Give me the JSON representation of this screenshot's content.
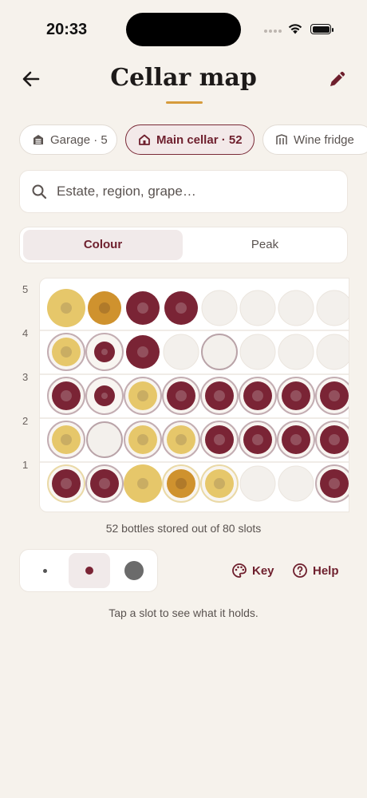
{
  "status_bar": {
    "time": "20:33"
  },
  "header": {
    "title": "Cellar map",
    "back_icon": "arrow-left-icon",
    "edit_icon": "pencil-icon",
    "accent_color": "#d69b3c"
  },
  "locations": [
    {
      "label": "Garage · 5",
      "icon": "garage-icon",
      "active": false
    },
    {
      "label": "Main cellar · 52",
      "icon": "house-icon",
      "active": true
    },
    {
      "label": "Wine fridge",
      "icon": "fridge-icon",
      "active": false
    }
  ],
  "search": {
    "placeholder": "Estate, region, grape…",
    "value": ""
  },
  "view_toggle": {
    "options": [
      "Colour",
      "Peak"
    ],
    "selected": "Colour"
  },
  "rack": {
    "row_labels": [
      "5",
      "4",
      "3",
      "2",
      "1"
    ],
    "visible_columns": 8,
    "colors": {
      "red": "#7a2435",
      "white": "#e6c76a",
      "amber": "#cf922e",
      "empty": "#f3f0ec"
    },
    "rows": [
      {
        "row": "5",
        "slots": [
          "white-large",
          "amber",
          "red",
          "red",
          "empty",
          "empty",
          "empty",
          "empty"
        ]
      },
      {
        "row": "4",
        "slots": [
          "white-ringed",
          "red-small-ringed",
          "red",
          "empty",
          "empty-ringed",
          "empty",
          "empty",
          "empty"
        ]
      },
      {
        "row": "3",
        "slots": [
          "red-ringed",
          "red-small-ringed",
          "white-ringed",
          "red-ringed",
          "red-ringed",
          "red-ringed",
          "red-ringed",
          "red-ringed"
        ]
      },
      {
        "row": "2",
        "slots": [
          "white-ringed",
          "empty-ringed",
          "white-ringed",
          "white-ringed",
          "red-ringed",
          "red-ringed",
          "red-ringed",
          "red-ringed"
        ]
      },
      {
        "row": "1",
        "slots": [
          "red-gold-ringed",
          "red-ringed",
          "white-large",
          "amber-gold-ringed",
          "white-gold-ringed",
          "empty",
          "empty",
          "red-ringed"
        ]
      }
    ]
  },
  "capacity_text": "52 bottles stored out of 80 slots",
  "dot_size": {
    "options": [
      "small",
      "medium",
      "large"
    ],
    "selected": "medium"
  },
  "actions": {
    "key_label": "Key",
    "key_icon": "palette-icon",
    "help_label": "Help",
    "help_icon": "question-circle-icon"
  },
  "hint": "Tap a slot to see what it holds.",
  "brand_color": "#6e1f2d"
}
